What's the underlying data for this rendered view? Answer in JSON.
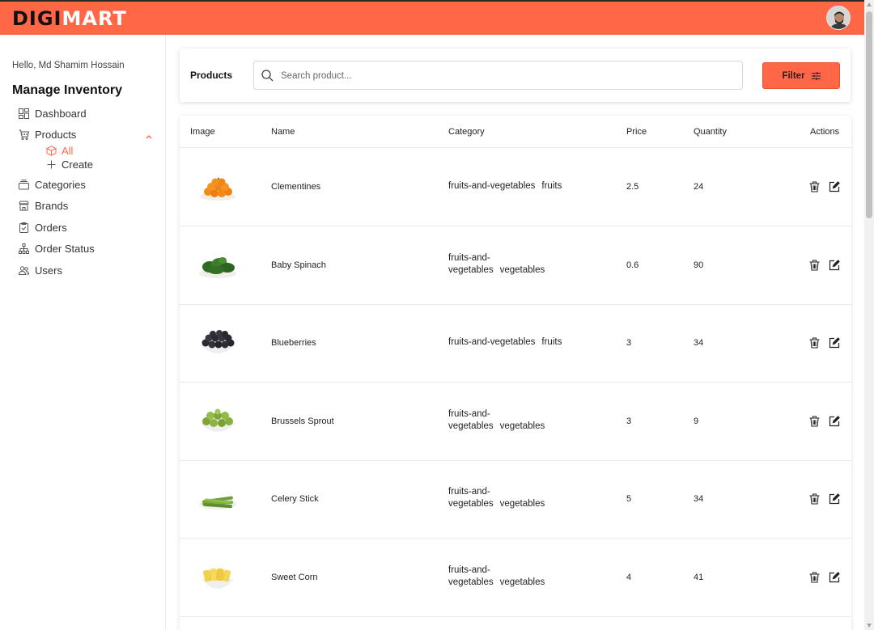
{
  "header": {
    "logo_part1": "DIGI",
    "logo_part2": "MART",
    "accent_color": "#ff6746"
  },
  "sidebar": {
    "greeting": "Hello, Md Shamim Hossain",
    "title": "Manage Inventory",
    "items": [
      {
        "label": "Dashboard",
        "icon": "dashboard-grid-icon"
      },
      {
        "label": "Products",
        "icon": "cart-icon"
      },
      {
        "label": "Categories",
        "icon": "categories-icon"
      },
      {
        "label": "Brands",
        "icon": "store-icon"
      },
      {
        "label": "Orders",
        "icon": "clipboard-icon"
      },
      {
        "label": "Order Status",
        "icon": "hierarchy-icon"
      },
      {
        "label": "Users",
        "icon": "users-icon"
      }
    ],
    "products_sub": [
      {
        "label": "All",
        "icon": "cube-icon",
        "active": true
      },
      {
        "label": "Create",
        "icon": "plus-icon",
        "active": false
      }
    ]
  },
  "search": {
    "label": "Products",
    "placeholder": "Search product...",
    "filter_label": "Filter"
  },
  "table": {
    "headers": [
      "Image",
      "Name",
      "Category",
      "Price",
      "Quantity",
      "Actions"
    ],
    "rows": [
      {
        "name": "Clementines",
        "cat1": "fruits-and-vegetables",
        "cat2": "fruits",
        "price": "2.5",
        "quantity": "24",
        "image": "clementines"
      },
      {
        "name": "Baby Spinach",
        "cat1": "fruits-and-vegetables",
        "cat2": "vegetables",
        "price": "0.6",
        "quantity": "90",
        "image": "spinach"
      },
      {
        "name": "Blueberries",
        "cat1": "fruits-and-vegetables",
        "cat2": "fruits",
        "price": "3",
        "quantity": "34",
        "image": "blueberries"
      },
      {
        "name": "Brussels Sprout",
        "cat1": "fruits-and-vegetables",
        "cat2": "vegetables",
        "price": "3",
        "quantity": "9",
        "image": "brussels"
      },
      {
        "name": "Celery Stick",
        "cat1": "fruits-and-vegetables",
        "cat2": "vegetables",
        "price": "5",
        "quantity": "34",
        "image": "celery"
      },
      {
        "name": "Sweet Corn",
        "cat1": "fruits-and-vegetables",
        "cat2": "vegetables",
        "price": "4",
        "quantity": "41",
        "image": "corn"
      }
    ]
  }
}
